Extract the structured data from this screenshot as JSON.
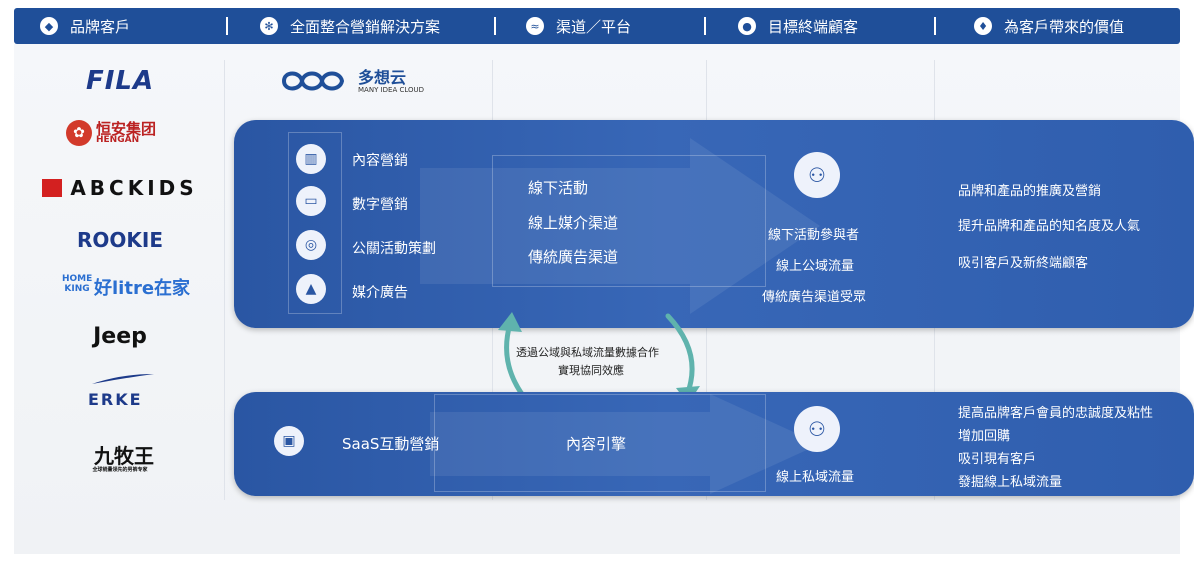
{
  "header": {
    "col1": "品牌客戶",
    "col2": "全面整合營銷解決方案",
    "col3": "渠道／平台",
    "col4": "目標終端顧客",
    "col5": "為客戶帶來的價值"
  },
  "logo": {
    "name": "多想云",
    "sub": "MANY IDEA CLOUD"
  },
  "brands": [
    "FILA",
    "恒安集团",
    "HENGAN",
    "ABCKIDS",
    "ROOKIE",
    "HOME KING",
    "好litre在家",
    "Jeep",
    "ERKE",
    "九牧王",
    "全球销量领先的男裤专家"
  ],
  "top_band": {
    "services": [
      "內容營銷",
      "數字營銷",
      "公關活動策劃",
      "媒介廣告"
    ],
    "channels": [
      "線下活動",
      "線上媒介渠道",
      "傳統廣告渠道"
    ],
    "customers": [
      "線下活動參與者",
      "線上公域流量",
      "傳統廣告渠道受眾"
    ],
    "values": [
      "品牌和產品的推廣及營銷",
      "提升品牌和產品的知名度及人氣",
      "吸引客戶及新終端顧客"
    ]
  },
  "middle_note": [
    "透過公域與私域流量數據合作",
    "實現協同效應"
  ],
  "bottom_band": {
    "service": "SaaS互動營銷",
    "channel": "內容引擎",
    "customer": "線上私域流量",
    "values": [
      "提高品牌客戶會員的忠誠度及粘性",
      "增加回購",
      "吸引現有客戶",
      "發掘線上私域流量"
    ]
  }
}
